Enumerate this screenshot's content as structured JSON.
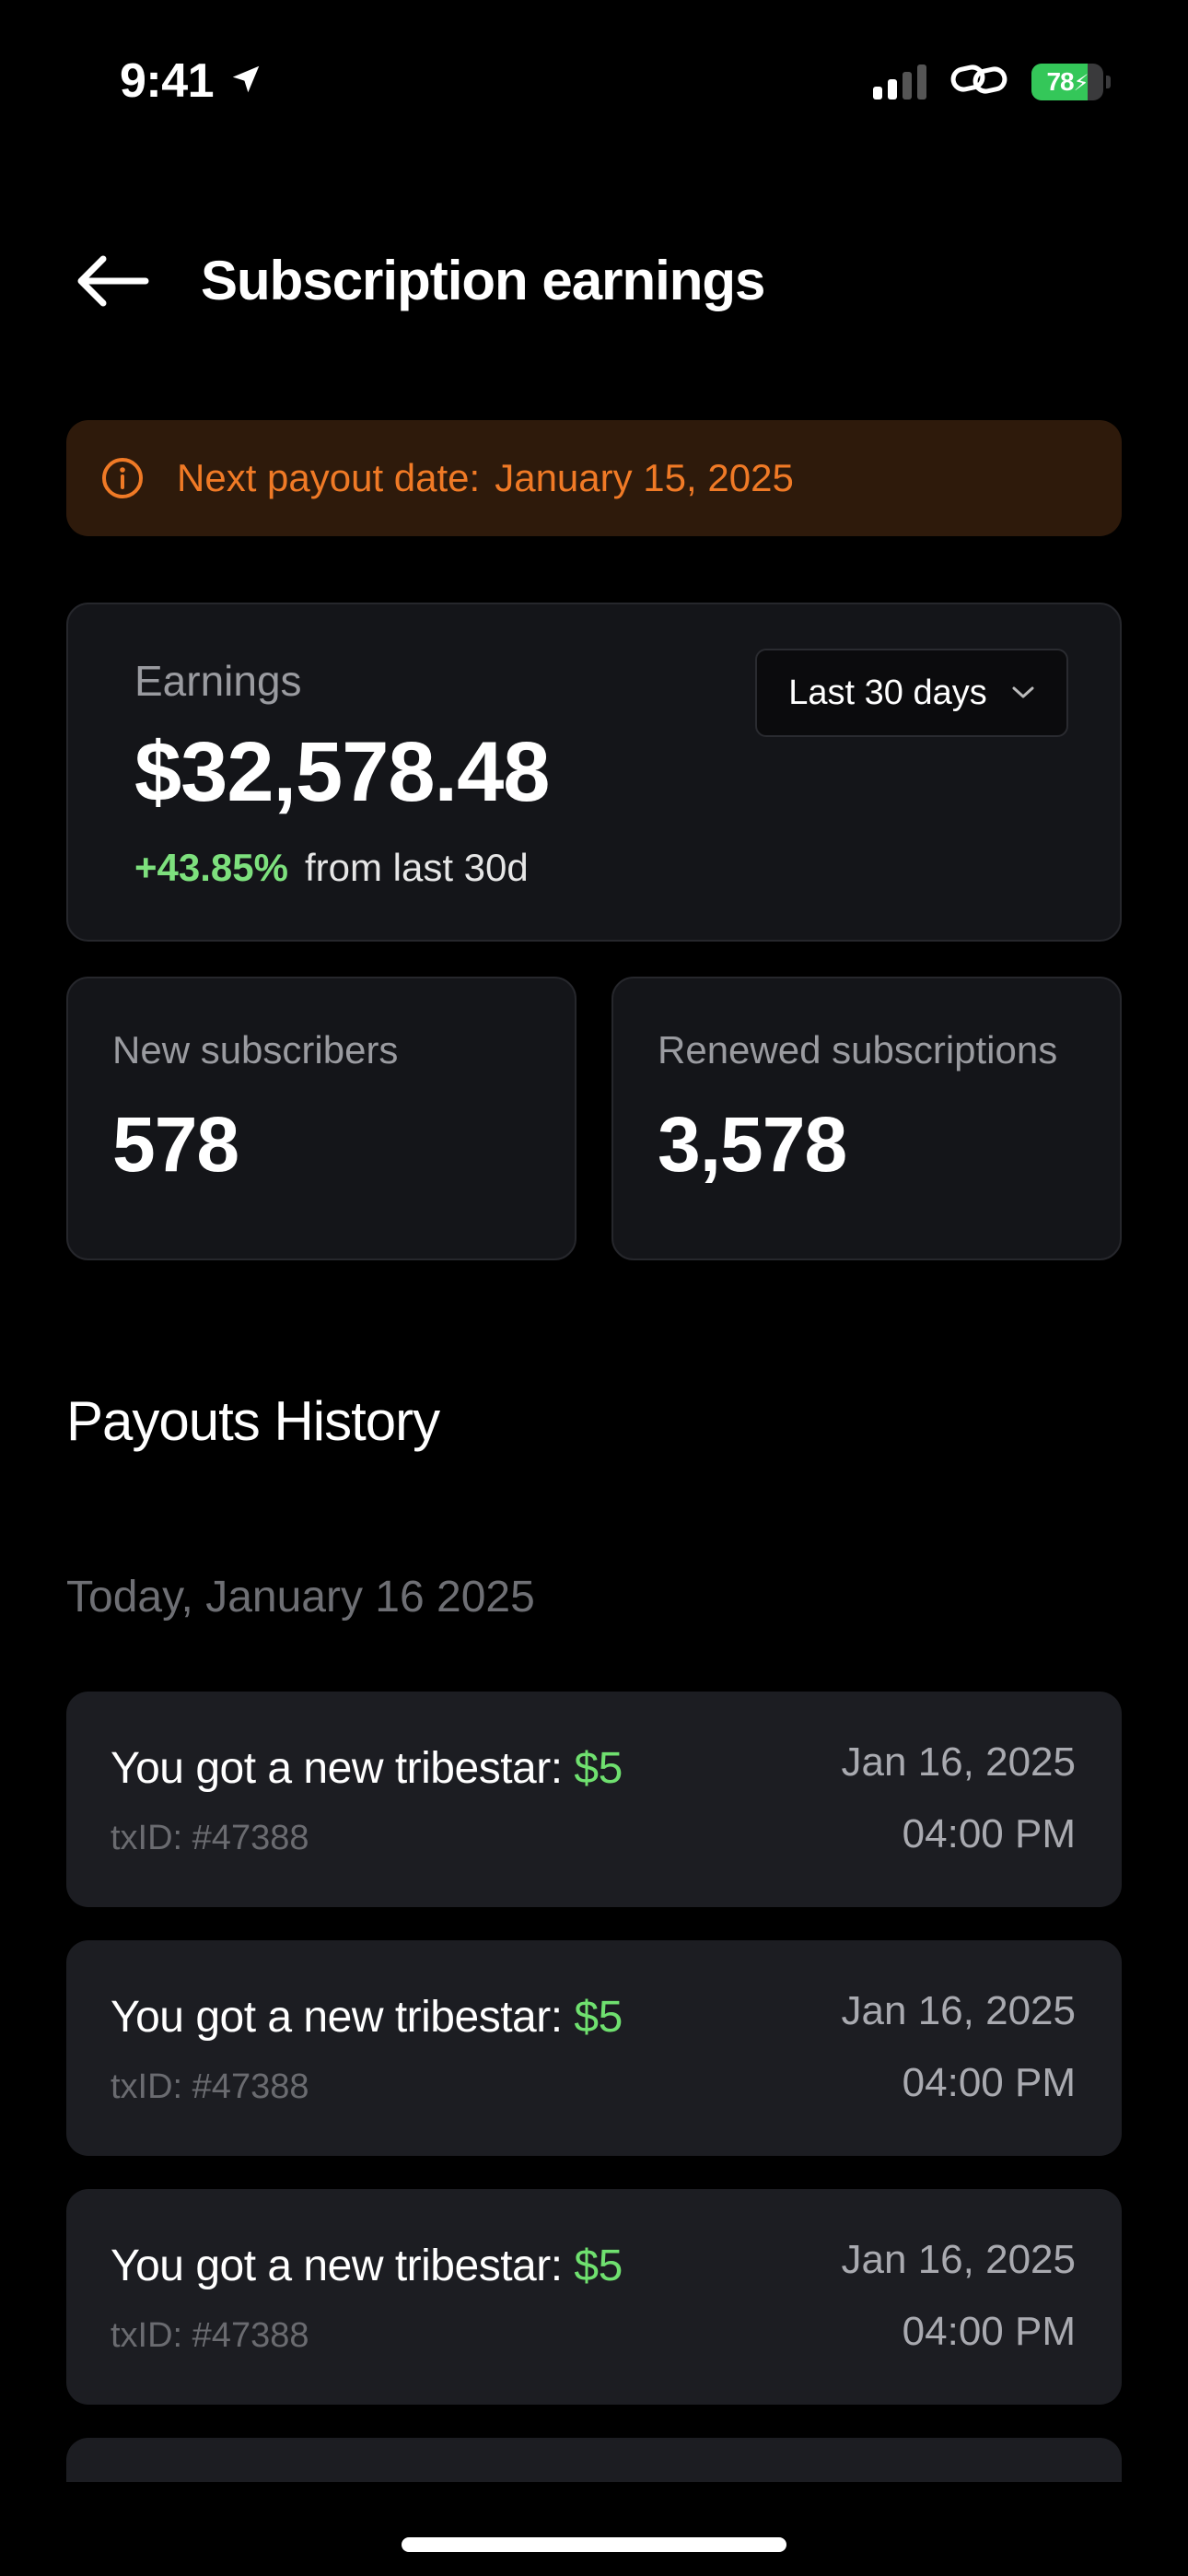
{
  "status_bar": {
    "time": "9:41",
    "battery": "78",
    "battery_level": 0.78,
    "icons": [
      "location-arrow-icon",
      "signal-icon",
      "link-icon",
      "battery-icon"
    ]
  },
  "header": {
    "title": "Subscription earnings",
    "back_icon": "arrow-left-icon"
  },
  "banner": {
    "label": "Next payout date:",
    "date": "January 15, 2025",
    "color": "#f07a26",
    "background": "#2e1a0b",
    "icon": "info-icon"
  },
  "earnings": {
    "label": "Earnings",
    "amount": "$32,578.48",
    "change": "+43.85%",
    "change_text": "from last 30d",
    "change_color": "#7de07d",
    "range": "Last 30 days"
  },
  "stats": [
    {
      "label": "New subscribers",
      "value": "578"
    },
    {
      "label": "Renewed subscriptions",
      "value": "3,578"
    }
  ],
  "payouts": {
    "title": "Payouts History",
    "group_label": "Today, January 16 2025",
    "items": [
      {
        "title": "You got a new tribestar:",
        "amount": "$5",
        "txid": "txID: #47388",
        "date": "Jan 16, 2025",
        "time": "04:00 PM"
      },
      {
        "title": "You got a new tribestar:",
        "amount": "$5",
        "txid": "txID: #47388",
        "date": "Jan 16, 2025",
        "time": "04:00 PM"
      },
      {
        "title": "You got a new tribestar:",
        "amount": "$5",
        "txid": "txID: #47388",
        "date": "Jan 16, 2025",
        "time": "04:00 PM"
      }
    ]
  }
}
